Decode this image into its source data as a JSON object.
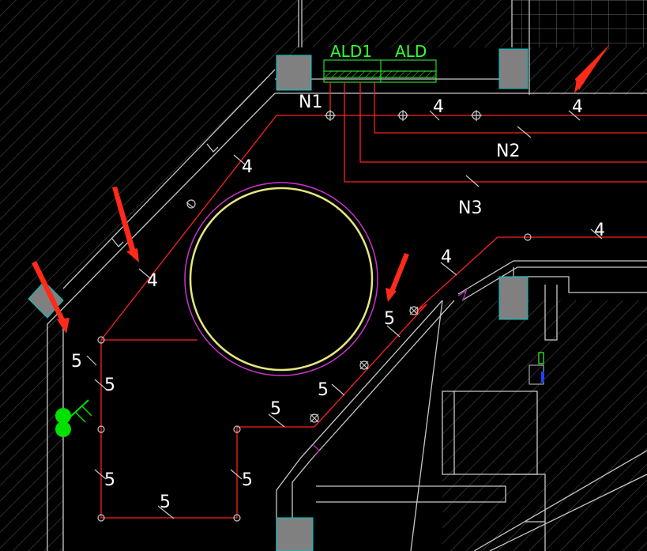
{
  "panels": [
    {
      "id": "ald1",
      "label": "ALD1"
    },
    {
      "id": "ald",
      "label": "ALD"
    }
  ],
  "circuits": {
    "n1": "N1",
    "n2": "N2",
    "n3": "N3"
  },
  "wire_counts": {
    "c1": "4",
    "c2": "4",
    "c3": "4",
    "c4": "4",
    "c5": "4",
    "c6": "4",
    "c7": "5",
    "c8": "5",
    "c9": "5",
    "c10": "5",
    "c11": "5",
    "c12": "5",
    "c13": "5",
    "c14": "5"
  },
  "colors": {
    "background": "#000000",
    "wire": "#ff2020",
    "wall": "#c8c8c8",
    "hatch": "#555555",
    "column": "#808080",
    "column_edge": "#00c8c8",
    "panel": "#33ff33",
    "circle_outer": "#cc33cc",
    "circle_inner": "#e6e680",
    "arrow": "#ff2a1a",
    "fixture": "#00e000"
  }
}
